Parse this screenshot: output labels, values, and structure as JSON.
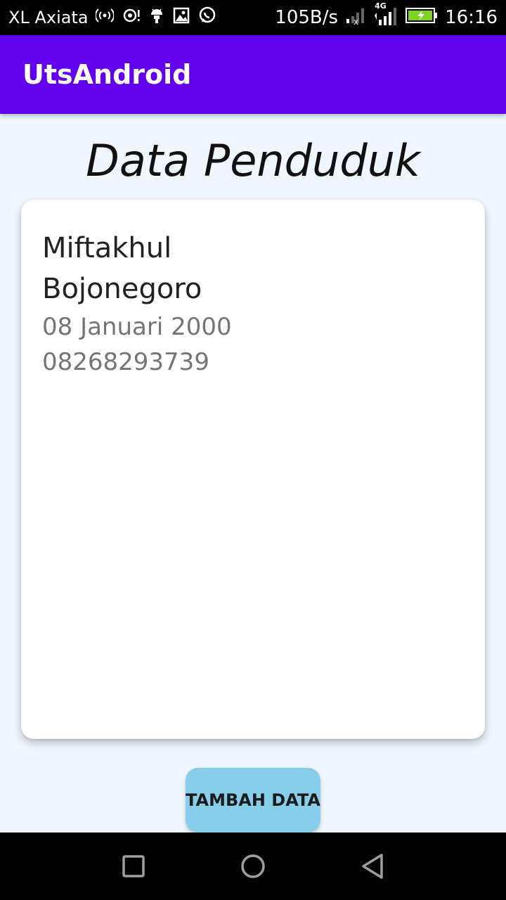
{
  "status_bar": {
    "carrier": "XL Axiata",
    "speed": "105B/s",
    "network": "4G",
    "time": "16:16",
    "icons": [
      "hotspot-icon",
      "data-saver-icon",
      "android-debug-icon",
      "gallery-icon",
      "whatsapp-icon",
      "signal-icon",
      "battery-charging-icon"
    ]
  },
  "app_bar": {
    "title": "UtsAndroid",
    "color": "#6200ee"
  },
  "page": {
    "heading": "Data Penduduk",
    "background": "#eff6fd"
  },
  "card": {
    "name": "Miftakhul",
    "city": "Bojonegoro",
    "dob": "08 Januari 2000",
    "phone": "08268293739"
  },
  "actions": {
    "add_label": "TAMBAH DATA",
    "add_color": "#87ceeb"
  },
  "nav_bar": {
    "items": [
      "recents-icon",
      "home-icon",
      "back-icon"
    ]
  }
}
